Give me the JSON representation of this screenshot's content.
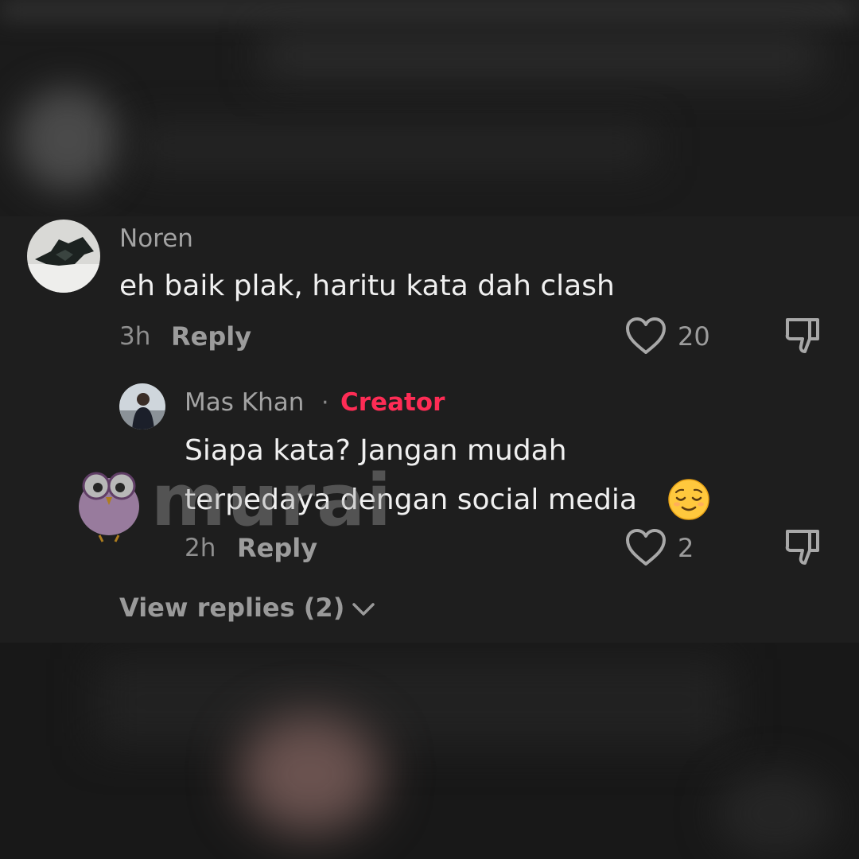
{
  "comments": [
    {
      "username": "Noren",
      "text": "eh baik plak, haritu kata dah clash",
      "time": "3h",
      "reply_label": "Reply",
      "likes": "20",
      "avatar_icon": "avatar-bat-icon",
      "replies": [
        {
          "username": "Mas Khan",
          "separator": "·",
          "badge": "Creator",
          "text_line1": "Siapa kata? Jangan mudah",
          "text_line2": "terpedaya dengan social media",
          "emoji": "relieved-face-icon",
          "time": "2h",
          "reply_label": "Reply",
          "likes": "2"
        }
      ],
      "view_replies_label": "View replies (2)"
    }
  ],
  "watermark": {
    "text": "murai",
    "icon": "owl-logo-icon"
  },
  "colors": {
    "background": "#1e1e1e",
    "creator_badge": "#fe2c55",
    "text_primary": "#f0f0f0",
    "text_secondary": "#9c9c9c"
  },
  "icons": {
    "like": "heart-outline-icon",
    "dislike": "thumbs-down-outline-icon",
    "expand": "chevron-down-icon"
  }
}
